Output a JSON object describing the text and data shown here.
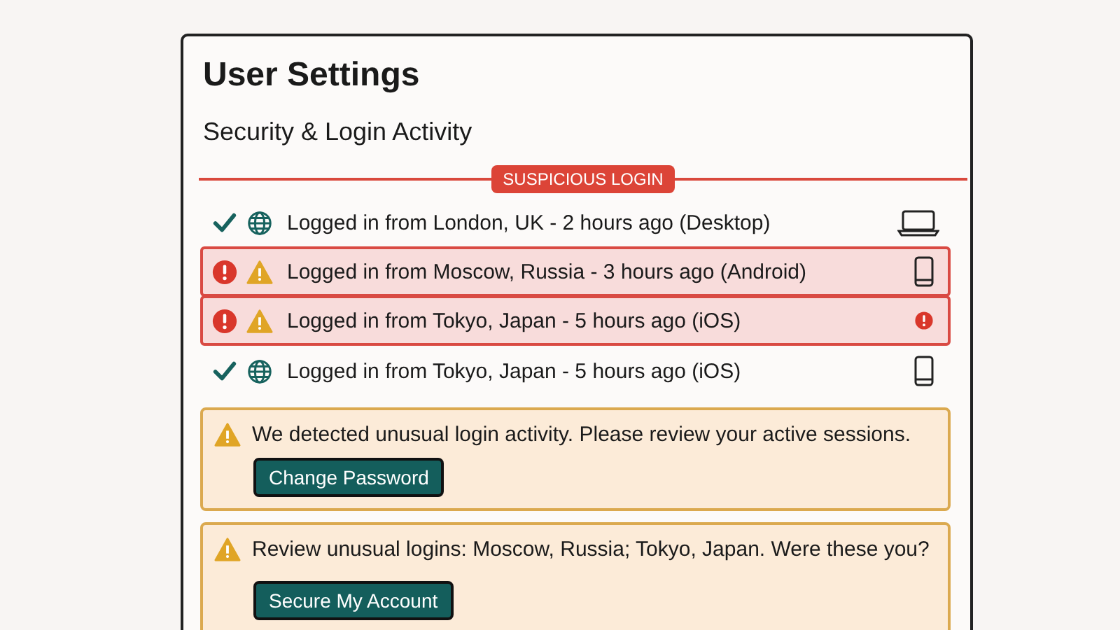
{
  "title": "User Settings",
  "section": {
    "title": "Security & Login Activity",
    "banner": "SUSPICIOUS LOGIN"
  },
  "logins": [
    {
      "text": "Logged in from London, UK - 2 hours ago (Desktop)",
      "suspicious": false,
      "kind": "desktop"
    },
    {
      "text": "Logged in from Moscow, Russia - 3 hours ago (Android)",
      "suspicious": true,
      "kind": "phone"
    },
    {
      "text": "Logged in from Tokyo, Japan - 5 hours ago (iOS)",
      "suspicious": true,
      "kind": "alert"
    },
    {
      "text": "Logged in from Tokyo, Japan - 5 hours ago (iOS)",
      "suspicious": false,
      "kind": "phone"
    }
  ],
  "alerts": [
    {
      "message": "We detected unusual login activity. Please review your active sessions.",
      "button": "Change Password"
    },
    {
      "message": "Review unusual logins: Moscow, Russia; Tokyo, Japan. Were these you?",
      "button": "Secure My Account"
    }
  ]
}
